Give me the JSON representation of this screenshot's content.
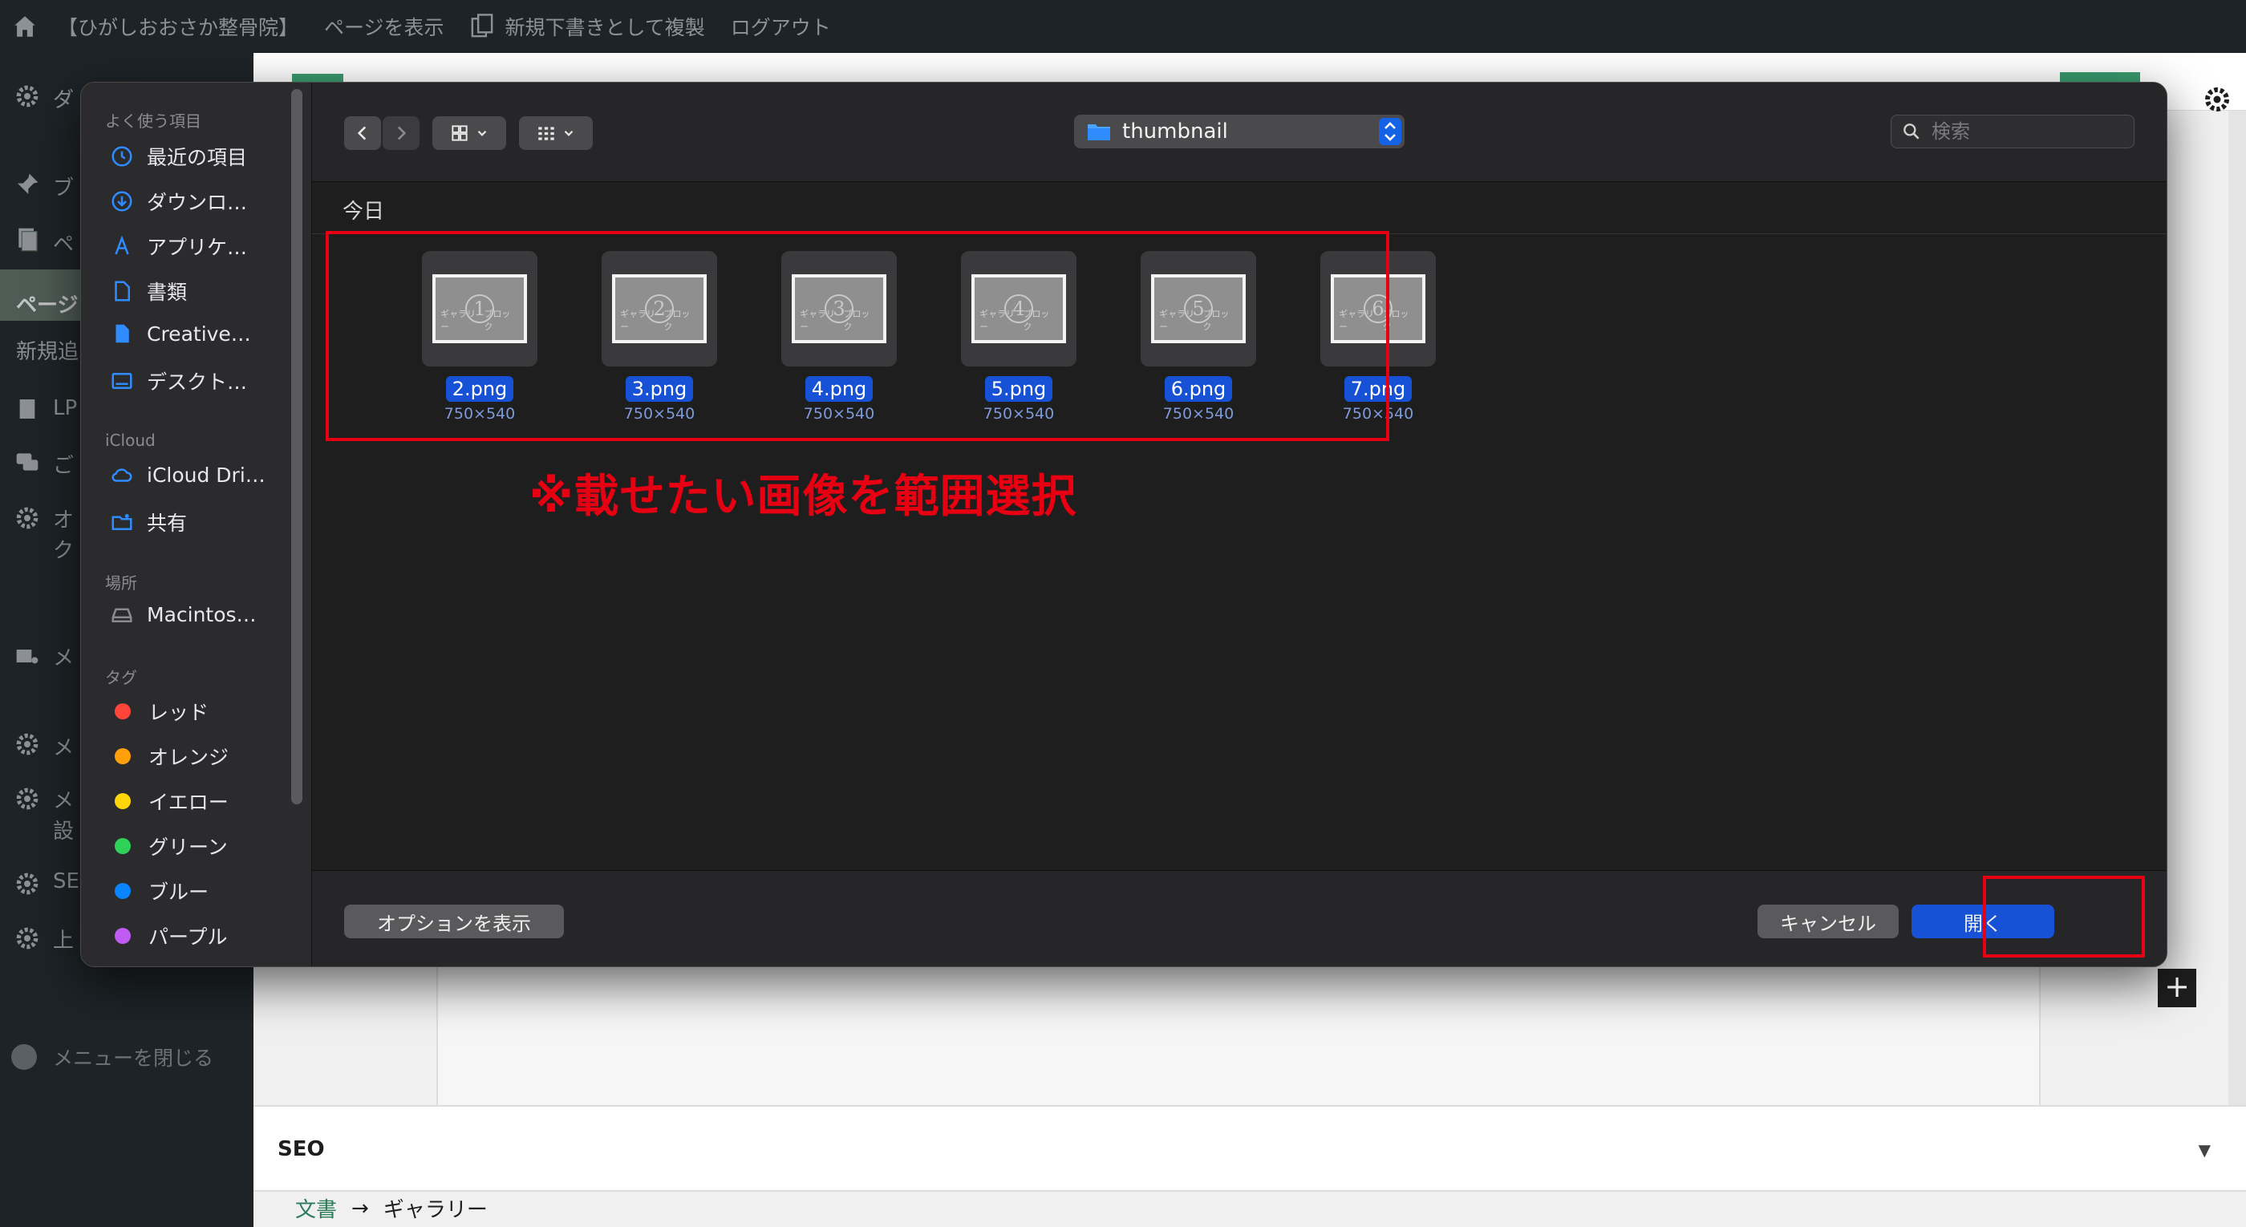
{
  "adminbar": {
    "site_name": "【ひがしおおさか整骨院】",
    "view_page": "ページを表示",
    "duplicate_draft": "新規下書きとして複製",
    "logout": "ログアウト"
  },
  "wp_sidebar": {
    "items": [
      "ダ",
      "ブ",
      "ペ",
      "ページ",
      "新規追",
      "LP",
      "ご",
      "オ",
      "ク",
      "メ",
      "メ",
      "メ",
      "設",
      "SE",
      "上"
    ],
    "close_menu": "メニューを閉じる"
  },
  "editor": {
    "seo_label": "SEO",
    "breadcrumb": [
      "文書",
      "→",
      "ギャラリー"
    ],
    "plus": "+"
  },
  "dialog": {
    "favorites_header": "よく使う項目",
    "favorites": [
      "最近の項目",
      "ダウンロ…",
      "アプリケ…",
      "書類",
      "Creative…",
      "デスクト…"
    ],
    "icloud_header": "iCloud",
    "icloud": [
      "iCloud Dri…",
      "共有"
    ],
    "locations_header": "場所",
    "locations": [
      "Macintos…"
    ],
    "tags_header": "タグ",
    "tags": [
      {
        "label": "レッド",
        "color": "#ff453a"
      },
      {
        "label": "オレンジ",
        "color": "#ff9f0a"
      },
      {
        "label": "イエロー",
        "color": "#ffd60a"
      },
      {
        "label": "グリーン",
        "color": "#30d158"
      },
      {
        "label": "ブルー",
        "color": "#0a84ff"
      },
      {
        "label": "パープル",
        "color": "#bf5af2"
      }
    ],
    "current_folder": "thumbnail",
    "search_placeholder": "検索",
    "group_header": "今日",
    "files": [
      {
        "name": "2.png",
        "dims": "750×540",
        "thumb_num": "1"
      },
      {
        "name": "3.png",
        "dims": "750×540",
        "thumb_num": "2"
      },
      {
        "name": "4.png",
        "dims": "750×540",
        "thumb_num": "3"
      },
      {
        "name": "5.png",
        "dims": "750×540",
        "thumb_num": "4"
      },
      {
        "name": "6.png",
        "dims": "750×540",
        "thumb_num": "5"
      },
      {
        "name": "7.png",
        "dims": "750×540",
        "thumb_num": "6"
      }
    ],
    "thumb_caption_left": "ギャラリー",
    "thumb_caption_right": "ブロック",
    "annotation": "※載せたい画像を範囲選択",
    "options_button": "オプションを表示",
    "cancel_button": "キャンセル",
    "open_button": "開く",
    "accent_color": "#1463e6",
    "annotation_color": "#e60012"
  }
}
